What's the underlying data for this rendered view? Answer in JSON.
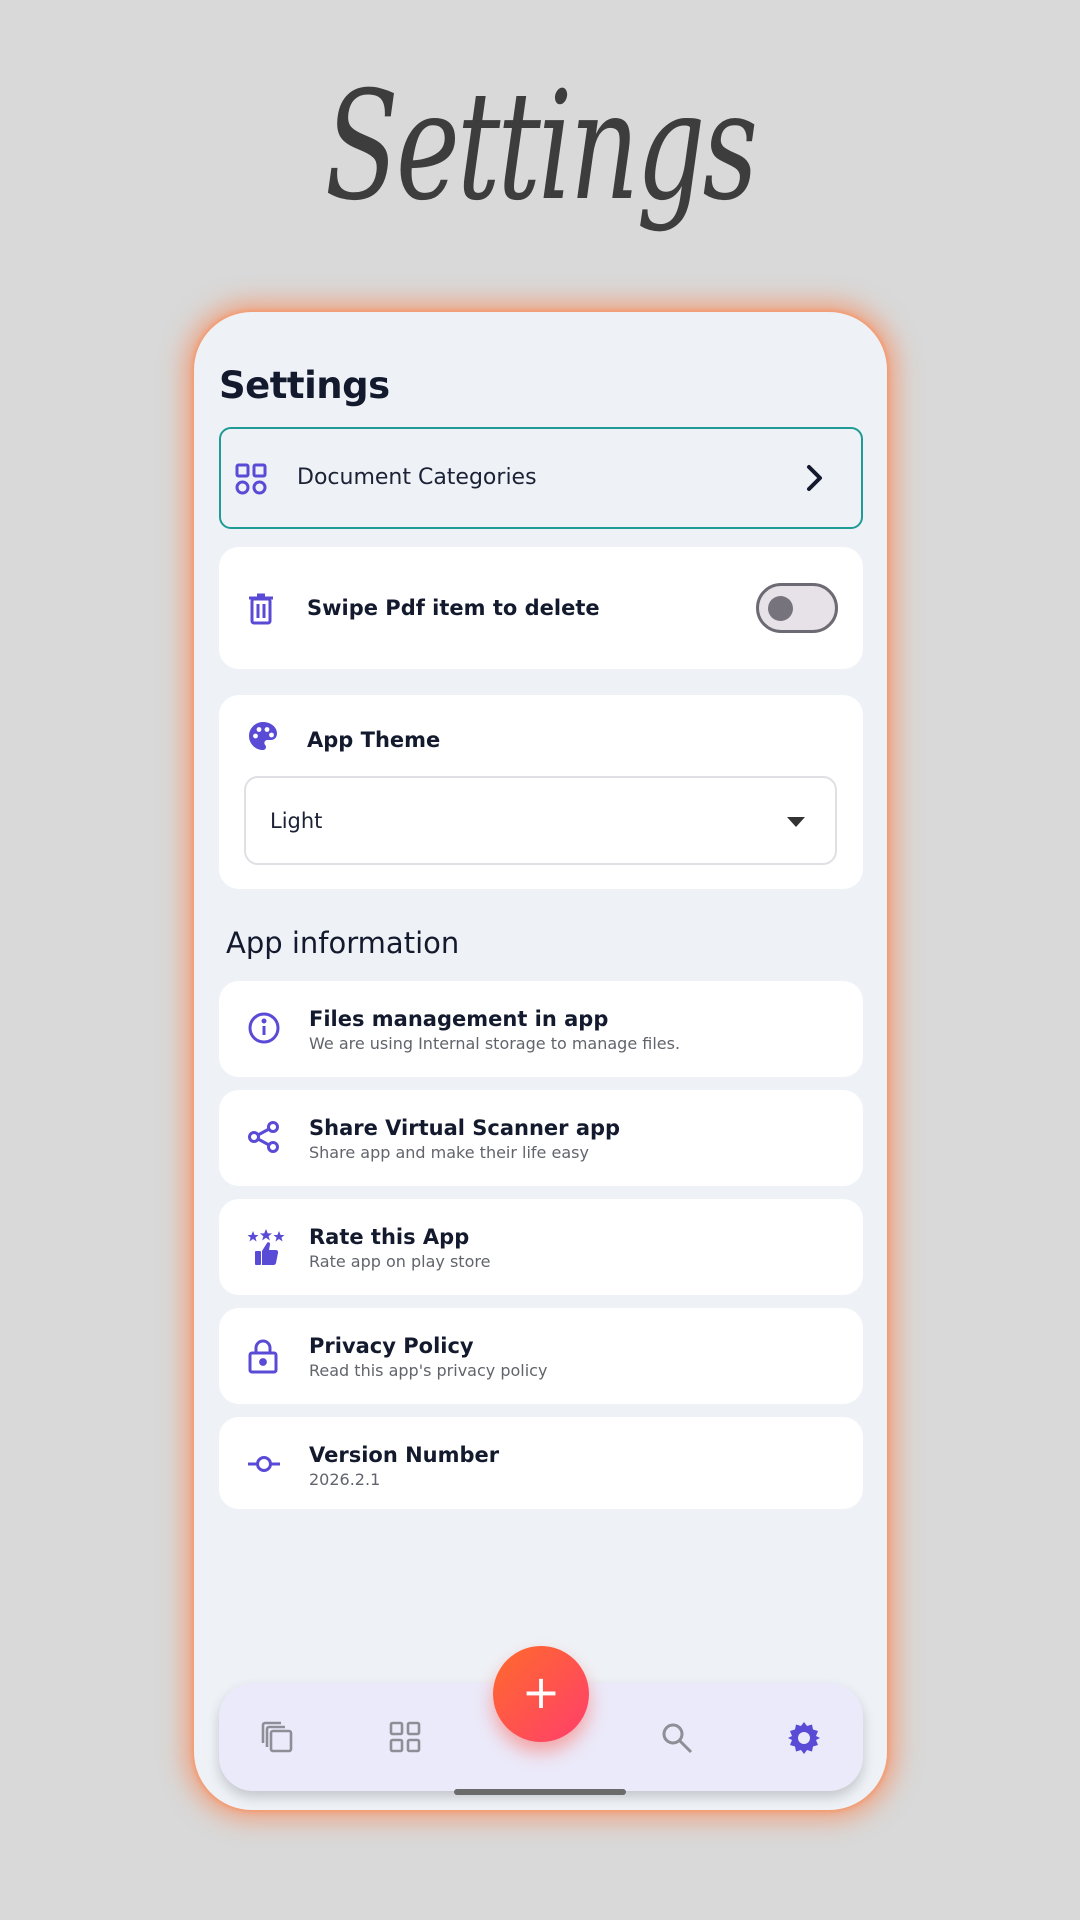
{
  "hero": {
    "title": "Settings"
  },
  "screen": {
    "title": "Settings"
  },
  "categories": {
    "label": "Document Categories",
    "icon": "grid-icon",
    "chevron": "chevron-right-icon"
  },
  "swipe": {
    "label": "Swipe Pdf item to delete",
    "icon": "trash-icon",
    "enabled": false
  },
  "theme": {
    "label": "App Theme",
    "icon": "palette-icon",
    "selected": "Light"
  },
  "app_info": {
    "heading": "App information",
    "items": [
      {
        "title": "Files management in app",
        "subtitle": "We are using Internal storage to manage files.",
        "icon": "info-icon"
      },
      {
        "title": "Share Virtual Scanner app",
        "subtitle": "Share app and make their life easy",
        "icon": "share-icon"
      },
      {
        "title": "Rate this App",
        "subtitle": "Rate app on play store",
        "icon": "rate-stars-icon"
      },
      {
        "title": "Privacy Policy",
        "subtitle": "Read this app's privacy policy",
        "icon": "lock-icon"
      },
      {
        "title": "Version Number",
        "subtitle": "2026.2.1",
        "icon": "commit-icon"
      }
    ]
  },
  "nav": {
    "items": [
      "documents-icon",
      "categories-icon",
      "add-icon",
      "search-icon",
      "settings-icon"
    ],
    "active": "settings-icon",
    "fab_label": "+"
  },
  "colors": {
    "accent": "#5a4bd6",
    "teal": "#1e9b94",
    "fab_start": "#ff6a2b",
    "fab_end": "#ff3f6c"
  }
}
